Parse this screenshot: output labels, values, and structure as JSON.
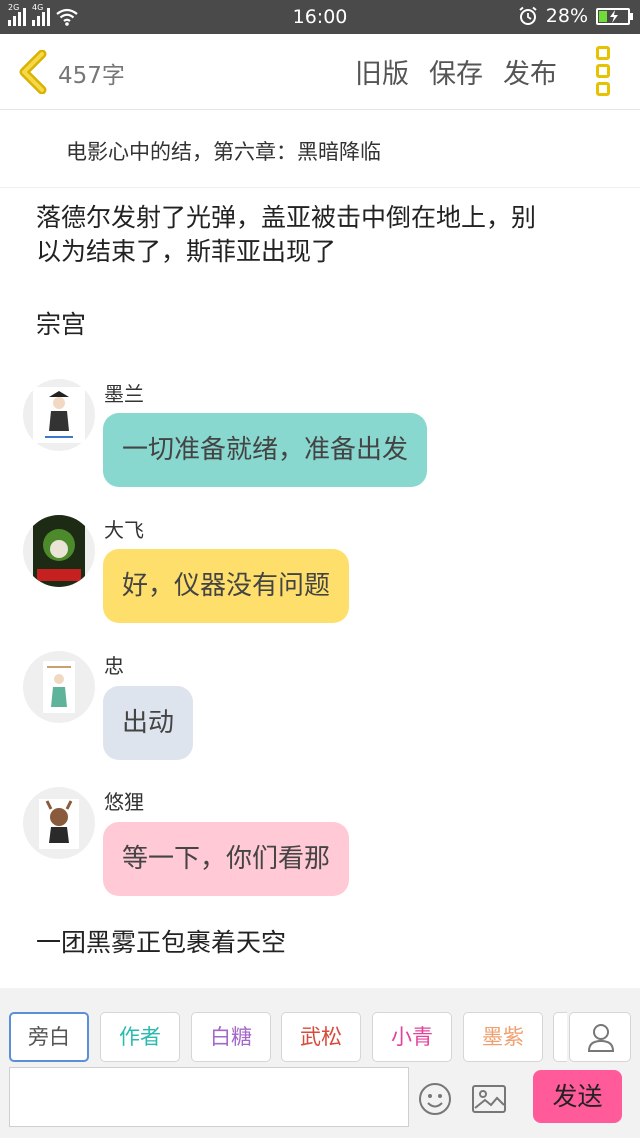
{
  "status_bar": {
    "signal1_label": "2G",
    "signal2_label": "4G",
    "time": "16:00",
    "battery_percent": "28%",
    "battery_level": 0.28
  },
  "header": {
    "word_count": "457字",
    "old_version": "旧版",
    "save": "保存",
    "publish": "发布"
  },
  "chapter_title": "电影心中的结，第六章：黑暗降临",
  "narration": {
    "line1a": "落德尔发射了光弹，盖亚被击中倒在地上，别",
    "line1b": "以为结束了，斯菲亚出现了",
    "line2": "宗宫",
    "line3": "一团黑雾正包裹着天空"
  },
  "messages": [
    {
      "sender": "墨兰",
      "text": "一切准备就绪，准备出发",
      "color": "#88d8cf"
    },
    {
      "sender": "大飞",
      "text": "好，仪器没有问题",
      "color": "#ffdf6b"
    },
    {
      "sender": "忠",
      "text": "出动",
      "color": "#dde4ee"
    },
    {
      "sender": "悠狸",
      "text": "等一下，你们看那",
      "color": "#ffc9d6"
    }
  ],
  "roles": [
    {
      "label": "旁白",
      "color": "#555555"
    },
    {
      "label": "作者",
      "color": "#2bbab0"
    },
    {
      "label": "白糖",
      "color": "#a468c9"
    },
    {
      "label": "武松",
      "color": "#d84a3a"
    },
    {
      "label": "小青",
      "color": "#e2449a"
    },
    {
      "label": "墨紫",
      "color": "#f0a070"
    }
  ],
  "composer": {
    "input_value": "",
    "send_label": "发送"
  },
  "colors": {
    "accent_yellow": "#e7c200",
    "send_pink": "#ff5a9a"
  }
}
